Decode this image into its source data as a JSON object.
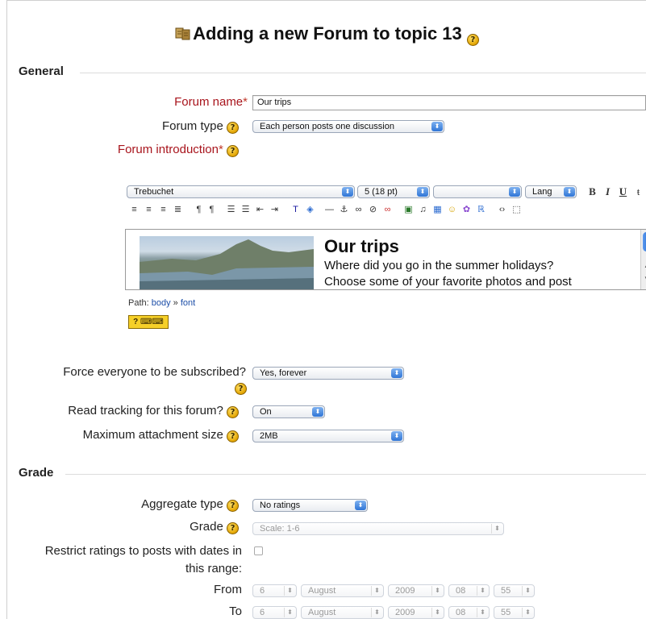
{
  "page": {
    "title": "Adding a new Forum to topic 13",
    "help_glyph": "?"
  },
  "general": {
    "legend": "General",
    "forum_name_label": "Forum name",
    "forum_name_value": "Our trips",
    "required_mark": "*",
    "forum_type_label": "Forum type",
    "forum_type_value": "Each person posts one discussion",
    "forum_intro_label": "Forum introduction"
  },
  "editor": {
    "font_family": "Trebuchet",
    "font_size": "5 (18 pt)",
    "format": "",
    "lang": "Lang",
    "bold": "B",
    "italic": "I",
    "underline": "U",
    "content_heading": "Our trips",
    "content_line1": "Where did you go in the summer holidays?",
    "content_line2": "Choose some of your favorite photos and post",
    "path_label": "Path:",
    "path_body": "body",
    "path_sep": "»",
    "path_font": "font"
  },
  "subscription": {
    "force_label": "Force everyone to be subscribed?",
    "force_value": "Yes, forever",
    "tracking_label": "Read tracking for this forum?",
    "tracking_value": "On",
    "max_attach_label": "Maximum attachment size",
    "max_attach_value": "2MB"
  },
  "grade": {
    "legend": "Grade",
    "aggregate_label": "Aggregate type",
    "aggregate_value": "No ratings",
    "grade_label": "Grade",
    "grade_value": "Scale: 1-6",
    "restrict_label_1": "Restrict ratings to posts with dates in",
    "restrict_label_2": "this range:",
    "from_label": "From",
    "to_label": "To",
    "from": {
      "day": "6",
      "month": "August",
      "year": "2009",
      "hour": "08",
      "minute": "55"
    },
    "to": {
      "day": "6",
      "month": "August",
      "year": "2009",
      "hour": "08",
      "minute": "55"
    }
  }
}
